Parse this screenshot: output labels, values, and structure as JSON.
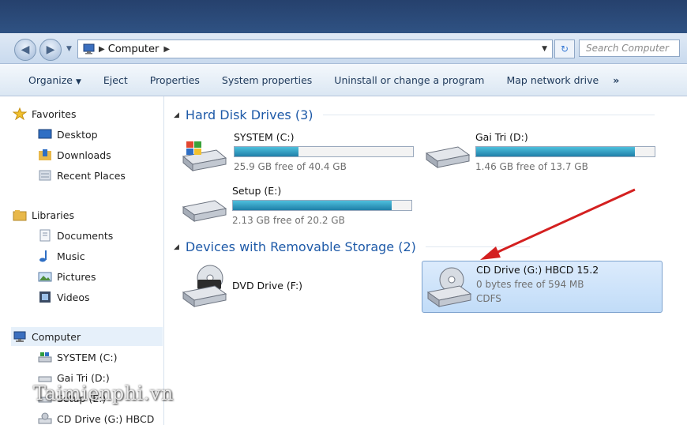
{
  "address": {
    "root_icon": "computer-icon",
    "crumb": "Computer"
  },
  "search": {
    "placeholder": "Search Computer"
  },
  "toolbar": {
    "items": [
      "Organize",
      "Eject",
      "Properties",
      "System properties",
      "Uninstall or change a program",
      "Map network drive"
    ],
    "more": "»"
  },
  "sidebar": {
    "favorites": "Favorites",
    "fav_items": [
      "Desktop",
      "Downloads",
      "Recent Places"
    ],
    "libraries": "Libraries",
    "lib_items": [
      "Documents",
      "Music",
      "Pictures",
      "Videos"
    ],
    "computer": "Computer",
    "comp_items": [
      "SYSTEM (C:)",
      "Gai Tri (D:)",
      "Setup (E:)",
      "CD Drive (G:) HBCD"
    ]
  },
  "groups": {
    "hdd": "Hard Disk Drives (3)",
    "removable": "Devices with Removable Storage (2)"
  },
  "drives": [
    {
      "name": "SYSTEM (C:)",
      "free": "25.9 GB free of 40.4 GB",
      "used_fraction": 0.36
    },
    {
      "name": "Gai Tri (D:)",
      "free": "1.46 GB free of 13.7 GB",
      "used_fraction": 0.89
    },
    {
      "name": "Setup (E:)",
      "free": "2.13 GB free of 20.2 GB",
      "used_fraction": 0.89
    }
  ],
  "removable": [
    {
      "name": "DVD Drive (F:)"
    },
    {
      "name": "CD Drive (G:) HBCD 15.2",
      "free": "0 bytes free of 594 MB",
      "fs": "CDFS"
    }
  ],
  "watermark": "Taimienphi.vn",
  "colors": {
    "accent": "#1e5aa8",
    "bar_fill": "#2a9fc6",
    "arrow": "#d42020"
  }
}
